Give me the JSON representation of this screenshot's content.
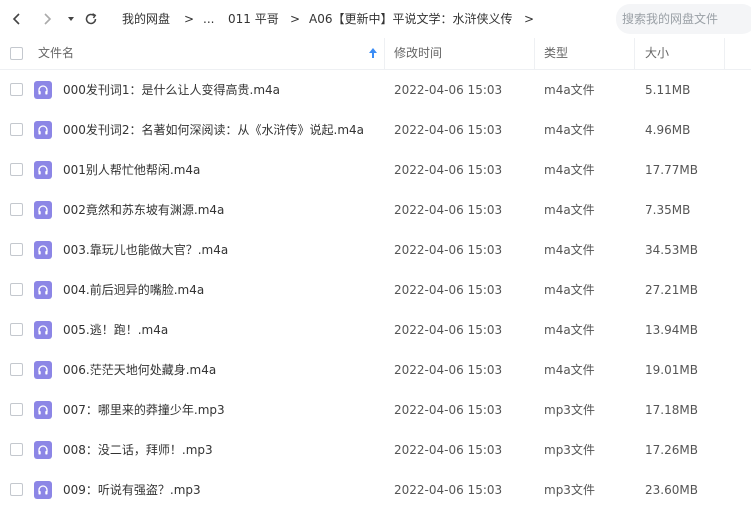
{
  "toolbar": {
    "icons": {
      "back": "chevron-left-icon",
      "forward": "chevron-right-icon",
      "dropdown": "caret-down-icon",
      "refresh": "refresh-icon"
    },
    "breadcrumb": [
      "我的网盘",
      "...",
      "011 平哥",
      "A06【更新中】平说文学：水浒侠义传"
    ],
    "separator": ">",
    "search_placeholder": "搜索我的网盘文件"
  },
  "columns": {
    "name": "文件名",
    "sort_icon": "sort-arrow-up-icon",
    "modified": "修改时间",
    "type": "类型",
    "size": "大小"
  },
  "files": [
    {
      "name": "000发刊词1：是什么让人变得高贵.m4a",
      "modified": "2022-04-06 15:03",
      "type": "m4a文件",
      "size": "5.11MB"
    },
    {
      "name": "000发刊词2：名著如何深阅读：从《水浒传》说起.m4a",
      "modified": "2022-04-06 15:03",
      "type": "m4a文件",
      "size": "4.96MB"
    },
    {
      "name": "001别人帮忙他帮闲.m4a",
      "modified": "2022-04-06 15:03",
      "type": "m4a文件",
      "size": "17.77MB"
    },
    {
      "name": "002竟然和苏东坡有渊源.m4a",
      "modified": "2022-04-06 15:03",
      "type": "m4a文件",
      "size": "7.35MB"
    },
    {
      "name": "003.靠玩儿也能做大官？.m4a",
      "modified": "2022-04-06 15:03",
      "type": "m4a文件",
      "size": "34.53MB"
    },
    {
      "name": "004.前后迥异的嘴脸.m4a",
      "modified": "2022-04-06 15:03",
      "type": "m4a文件",
      "size": "27.21MB"
    },
    {
      "name": "005.逃！跑！.m4a",
      "modified": "2022-04-06 15:03",
      "type": "m4a文件",
      "size": "13.94MB"
    },
    {
      "name": "006.茫茫天地何处藏身.m4a",
      "modified": "2022-04-06 15:03",
      "type": "m4a文件",
      "size": "19.01MB"
    },
    {
      "name": "007：哪里来的莽撞少年.mp3",
      "modified": "2022-04-06 15:03",
      "type": "mp3文件",
      "size": "17.18MB"
    },
    {
      "name": "008：没二话，拜师！.mp3",
      "modified": "2022-04-06 15:03",
      "type": "mp3文件",
      "size": "17.26MB"
    },
    {
      "name": "009：听说有强盗？.mp3",
      "modified": "2022-04-06 15:03",
      "type": "mp3文件",
      "size": "23.60MB"
    }
  ],
  "file_icon": "audio-headphones-icon",
  "colors": {
    "audio_icon": "#8c86e6",
    "sort_arrow": "#3b8cf5"
  }
}
